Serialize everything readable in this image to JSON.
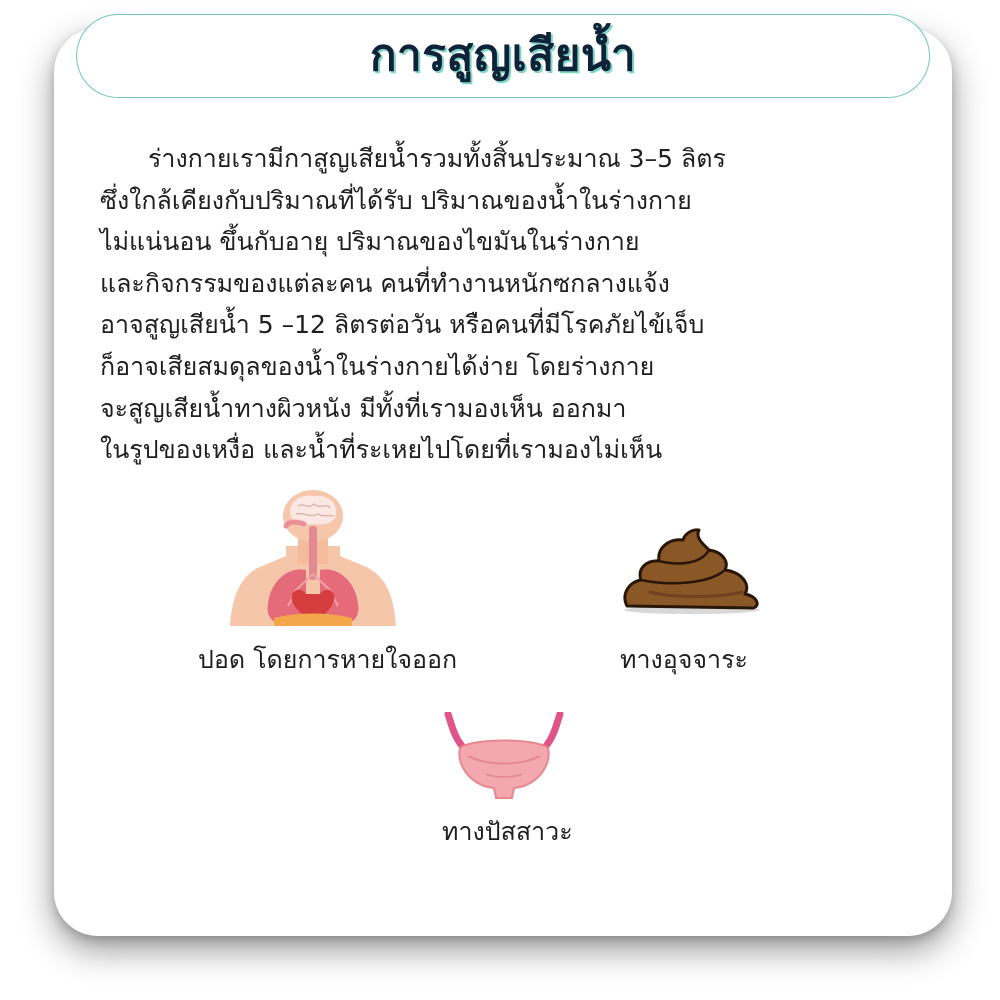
{
  "title": "การสูญเสียน้ำ",
  "paragraph_lines": [
    "ร่างกายเรามีกาสูญเสียน้ำรวมทั้งสิ้นประมาณ 3–5 ลิตร",
    "ซึ่งใกล้เคียงกับปริมาณที่ได้รับ ปริมาณของน้ำในร่างกาย",
    "ไม่แน่นอน ขึ้นกับอายุ ปริมาณของไขมันในร่างกาย",
    "และกิจกรรมของแต่ละคน คนที่ทำงานหนักซกลางแจ้ง",
    "อาจสูญเสียน้ำ 5 –12 ลิตรต่อวัน  หรือคนที่มีโรคภัยไข้เจ็บ",
    "ก็อาจเสียสมดุลของน้ำในร่างกายได้ง่าย โดยร่างกาย",
    "จะสูญเสียน้ำทางผิวหนัง มีทั้งที่เรามองเห็น ออกมา",
    "ในรูปของเหงื่อ และน้ำที่ระเหยไปโดยที่เรามองไม่เห็น"
  ],
  "items": [
    {
      "caption": "ปอด โดยการหายใจออก",
      "icon": "lungs-icon"
    },
    {
      "caption": "ทางอุจจาระ",
      "icon": "feces-icon"
    },
    {
      "caption": "ทางปัสสาวะ",
      "icon": "bladder-icon"
    }
  ],
  "colors": {
    "title_text": "#0f2238",
    "title_shadow": "#7fd6c6",
    "title_border": "#6fc7b8",
    "body_text": "#1f1f1f"
  }
}
